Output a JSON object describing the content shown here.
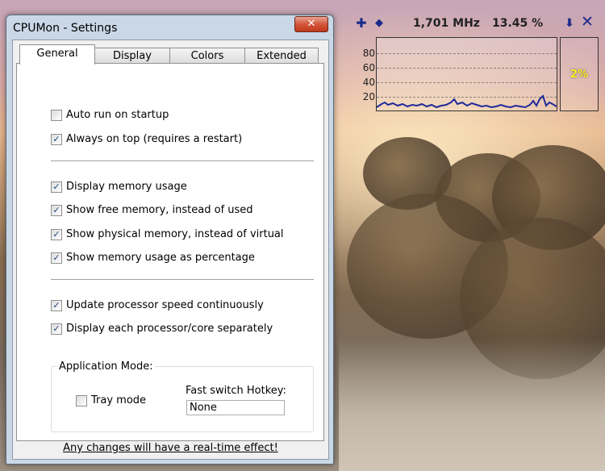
{
  "window": {
    "title": "CPUMon - Settings",
    "close_label": "✕"
  },
  "tabs": [
    {
      "label": "General",
      "active": true
    },
    {
      "label": "Display",
      "active": false
    },
    {
      "label": "Colors",
      "active": false
    },
    {
      "label": "Extended",
      "active": false
    }
  ],
  "options": {
    "auto_run": {
      "label": "Auto run on startup",
      "checked": false
    },
    "always_on_top": {
      "label": "Always on top (requires a restart)",
      "checked": true
    },
    "display_memory": {
      "label": "Display memory usage",
      "checked": true
    },
    "show_free": {
      "label": "Show free memory, instead of used",
      "checked": true
    },
    "show_physical": {
      "label": "Show physical memory, instead of virtual",
      "checked": true
    },
    "show_percentage": {
      "label": "Show memory usage as percentage",
      "checked": true
    },
    "update_speed": {
      "label": "Update processor speed continuously",
      "checked": true
    },
    "each_core": {
      "label": "Display each processor/core separately",
      "checked": true
    }
  },
  "app_mode": {
    "title": "Application Mode:",
    "tray_mode": {
      "label": "Tray mode",
      "checked": false
    },
    "hotkey_label": "Fast switch Hotkey:",
    "hotkey_value": "None"
  },
  "footer": "Any changes will have a real-time effect!",
  "widget": {
    "speed": "1,701 MHz",
    "usage": "13.45 %",
    "bar_percent": "2%",
    "y_ticks": [
      "80",
      "60",
      "40",
      "20"
    ],
    "line_color": "#1f2b9a",
    "bar_color": "#ffee22"
  }
}
